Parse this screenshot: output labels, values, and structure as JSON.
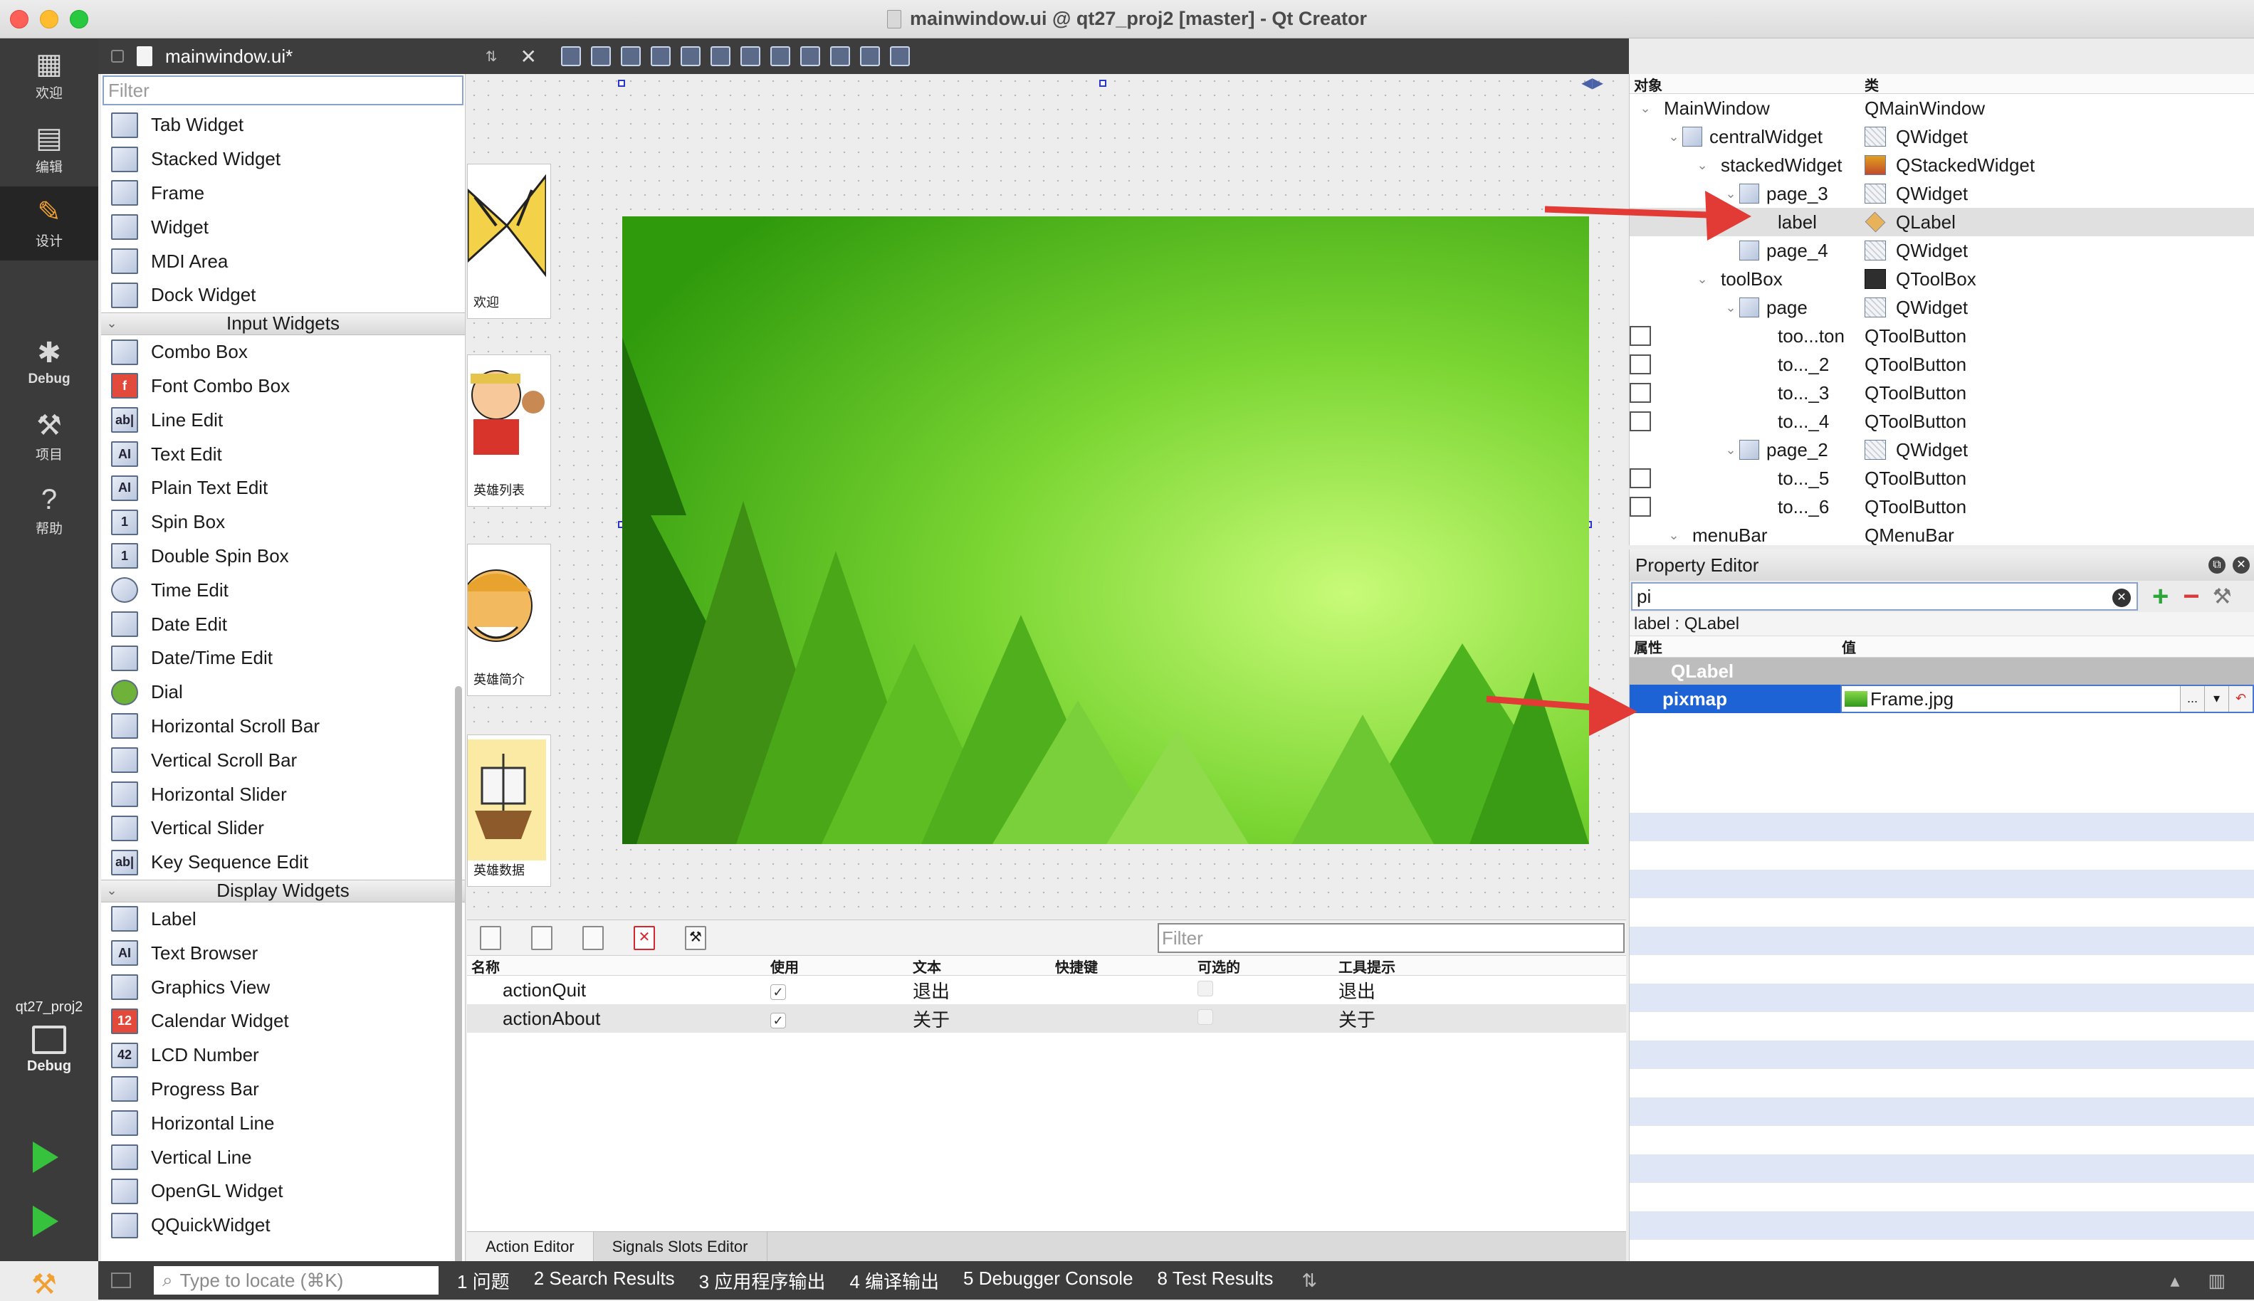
{
  "window": {
    "title": "mainwindow.ui @ qt27_proj2 [master] - Qt Creator"
  },
  "modes": [
    {
      "label": "欢迎",
      "icon": "grid-icon"
    },
    {
      "label": "编辑",
      "icon": "document-icon"
    },
    {
      "label": "设计",
      "icon": "pencil-icon"
    },
    {
      "label": "Debug",
      "icon": "bug-icon"
    },
    {
      "label": "项目",
      "icon": "wrench-icon"
    },
    {
      "label": "帮助",
      "icon": "help-icon"
    }
  ],
  "kit": {
    "project": "qt27_proj2",
    "mode": "Debug"
  },
  "document": {
    "file_name": "mainwindow.ui*"
  },
  "widget_box": {
    "filter_placeholder": "Filter",
    "containers": [
      "Tab Widget",
      "Stacked Widget",
      "Frame",
      "Widget",
      "MDI Area",
      "Dock Widget"
    ],
    "input_category": "Input Widgets",
    "input_widgets": [
      "Combo Box",
      "Font Combo Box",
      "Line Edit",
      "Text Edit",
      "Plain Text Edit",
      "Spin Box",
      "Double Spin Box",
      "Time Edit",
      "Date Edit",
      "Date/Time Edit",
      "Dial",
      "Horizontal Scroll Bar",
      "Vertical Scroll Bar",
      "Horizontal Slider",
      "Vertical Slider",
      "Key Sequence Edit"
    ],
    "display_category": "Display Widgets",
    "display_widgets": [
      "Label",
      "Text Browser",
      "Graphics View",
      "Calendar Widget",
      "LCD Number",
      "Progress Bar",
      "Horizontal Line",
      "Vertical Line",
      "OpenGL Widget",
      "QQuickWidget"
    ]
  },
  "form": {
    "toolbox_buttons": [
      "欢迎",
      "英雄列表",
      "英雄简介",
      "英雄数据"
    ]
  },
  "action_editor": {
    "filter_placeholder": "Filter",
    "columns": [
      "名称",
      "使用",
      "文本",
      "快捷键",
      "可选的",
      "工具提示"
    ],
    "rows": [
      {
        "name": "actionQuit",
        "used": true,
        "text": "退出",
        "shortcut": "",
        "checkable": false,
        "tooltip": "退出"
      },
      {
        "name": "actionAbout",
        "used": true,
        "text": "关于",
        "shortcut": "",
        "checkable": false,
        "tooltip": "关于"
      }
    ],
    "tabs": [
      "Action Editor",
      "Signals  Slots Editor"
    ]
  },
  "object_inspector": {
    "columns": [
      "对象",
      "类"
    ],
    "rows": [
      {
        "name": "MainWindow",
        "class": "QMainWindow",
        "indent": 0,
        "chevron": true
      },
      {
        "name": "centralWidget",
        "class": "QWidget",
        "indent": 1,
        "chevron": true
      },
      {
        "name": "stackedWidget",
        "class": "QStackedWidget",
        "indent": 2,
        "chevron": true
      },
      {
        "name": "page_3",
        "class": "QWidget",
        "indent": 3,
        "chevron": true
      },
      {
        "name": "label",
        "class": "QLabel",
        "indent": 4,
        "chevron": false
      },
      {
        "name": "page_4",
        "class": "QWidget",
        "indent": 3,
        "chevron": false
      },
      {
        "name": "toolBox",
        "class": "QToolBox",
        "indent": 2,
        "chevron": true
      },
      {
        "name": "page",
        "class": "QWidget",
        "indent": 3,
        "chevron": true
      },
      {
        "name": "too...ton",
        "class": "QToolButton",
        "indent": 4,
        "chevron": false
      },
      {
        "name": "to..._2",
        "class": "QToolButton",
        "indent": 4,
        "chevron": false
      },
      {
        "name": "to..._3",
        "class": "QToolButton",
        "indent": 4,
        "chevron": false
      },
      {
        "name": "to..._4",
        "class": "QToolButton",
        "indent": 4,
        "chevron": false
      },
      {
        "name": "page_2",
        "class": "QWidget",
        "indent": 3,
        "chevron": true
      },
      {
        "name": "to..._5",
        "class": "QToolButton",
        "indent": 4,
        "chevron": false
      },
      {
        "name": "to..._6",
        "class": "QToolButton",
        "indent": 4,
        "chevron": false
      },
      {
        "name": "menuBar",
        "class": "QMenuBar",
        "indent": 1,
        "chevron": true
      }
    ],
    "selected_index": 4
  },
  "property_editor": {
    "title": "Property Editor",
    "search_value": "pi",
    "object_line": "label : QLabel",
    "columns": [
      "属性",
      "值"
    ],
    "group": "QLabel",
    "property_name": "pixmap",
    "property_value": "Frame.jpg",
    "dots_label": "..."
  },
  "status_bar": {
    "locator_placeholder": "Type to locate (⌘K)",
    "panes": [
      "1  问题",
      "2  Search Results",
      "3  应用程序输出",
      "4  编译输出",
      "5  Debugger Console",
      "8  Test Results"
    ]
  },
  "colors": {
    "accent_selection": "#1e63d6",
    "annotation_arrow": "#e23b36",
    "scene_green": "#4cbf1c"
  }
}
